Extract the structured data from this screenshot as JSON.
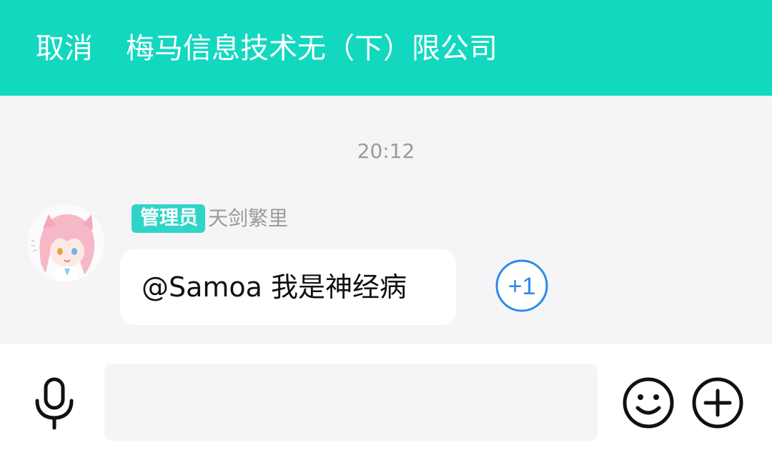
{
  "header": {
    "cancel_label": "取消",
    "title": "梅马信息技术无（下）限公司",
    "background_color": "#13d8c0"
  },
  "chat": {
    "timestamp": "20:12",
    "messages": [
      {
        "sender": {
          "role_badge": "管理员",
          "name": "天剑繁里",
          "avatar": "anime-girl-avatar"
        },
        "text": "@Samoa 我是神经病"
      }
    ],
    "plus_one_label": "+1",
    "plus_one_color": "#2a8be6"
  },
  "input_bar": {
    "voice_icon": "microphone-icon",
    "message_input_placeholder": "",
    "message_input_value": "",
    "emoji_icon": "smiley-face-icon",
    "more_icon": "plus-circle-icon"
  }
}
